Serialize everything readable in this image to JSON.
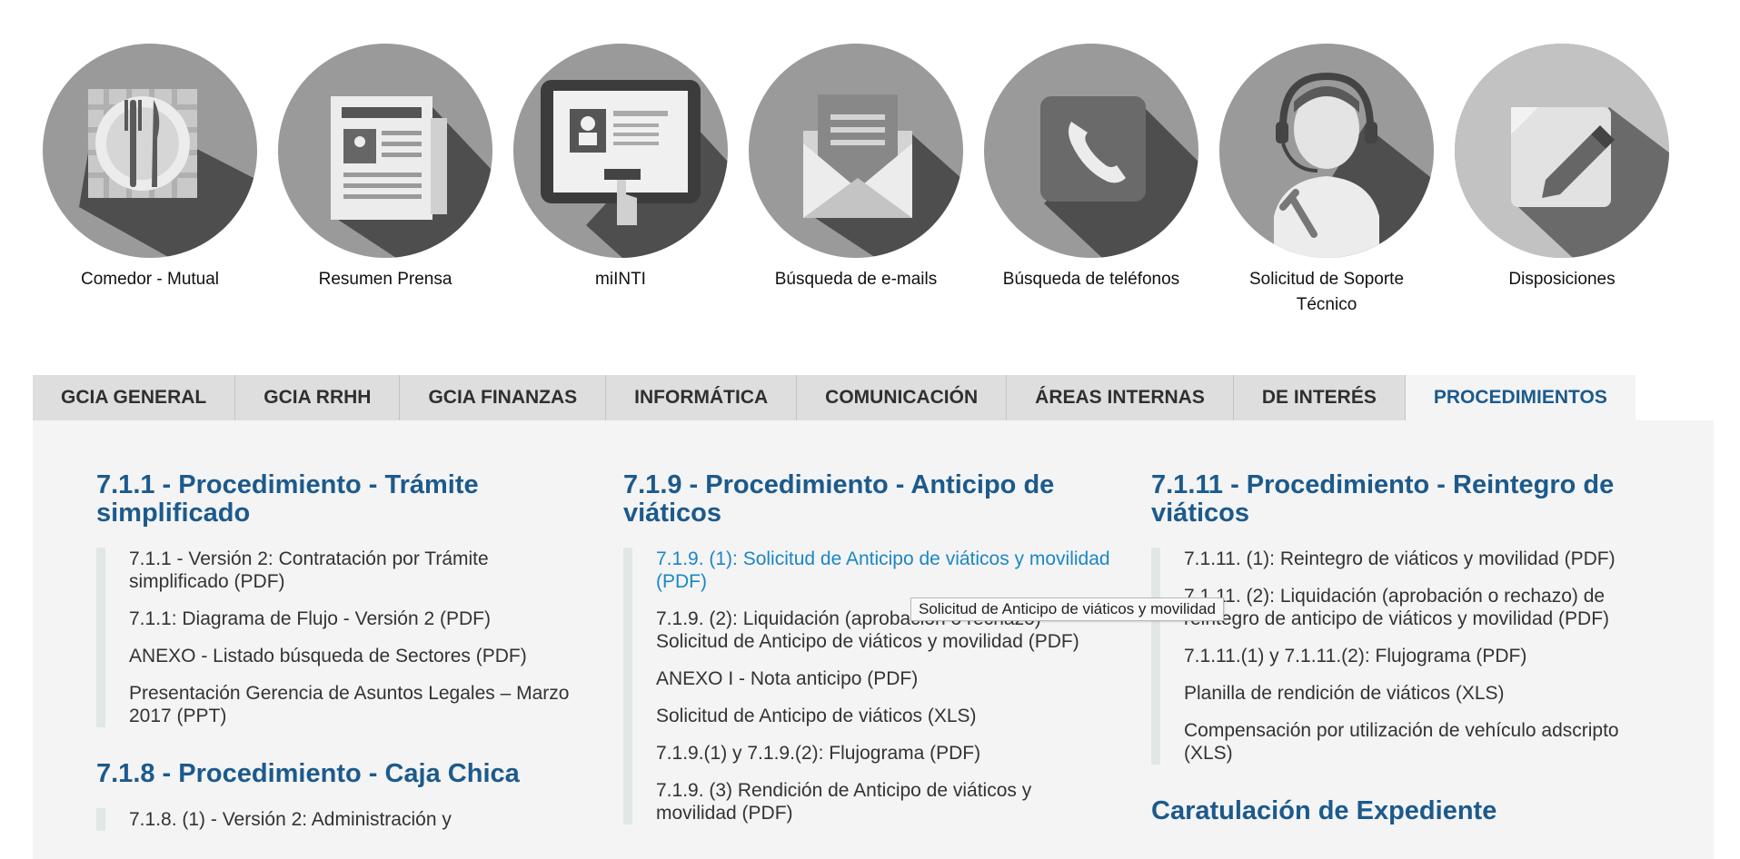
{
  "shortcuts": [
    {
      "label": "Comedor - Mutual",
      "icon": "dining-icon"
    },
    {
      "label": "Resumen Prensa",
      "icon": "newspaper-icon"
    },
    {
      "label": "miINTI",
      "icon": "tablet-profile-icon"
    },
    {
      "label": "Búsqueda de e-mails",
      "icon": "envelope-icon"
    },
    {
      "label": "Búsqueda de teléfonos",
      "icon": "phone-icon"
    },
    {
      "label": "Solicitud de Soporte Técnico",
      "icon": "support-agent-icon"
    },
    {
      "label": "Disposiciones",
      "icon": "pencil-note-icon"
    }
  ],
  "tabs": [
    {
      "label": "GCIA GENERAL"
    },
    {
      "label": "GCIA RRHH"
    },
    {
      "label": "GCIA FINANZAS"
    },
    {
      "label": "INFORMÁTICA"
    },
    {
      "label": "COMUNICACIÓN"
    },
    {
      "label": "ÁREAS INTERNAS"
    },
    {
      "label": "DE INTERÉS"
    },
    {
      "label": "PROCEDIMIENTOS",
      "active": true
    }
  ],
  "columns": [
    {
      "sections": [
        {
          "title": "7.1.1 - Procedimiento - Trámite simplificado",
          "items": [
            "7.1.1 - Versión 2: Contratación por Trámite simplificado (PDF)",
            "7.1.1: Diagrama de Flujo - Versión 2 (PDF)",
            "ANEXO - Listado búsqueda de Sectores (PDF)",
            "Presentación Gerencia de Asuntos Legales – Marzo 2017 (PPT)"
          ]
        },
        {
          "title": "7.1.8 - Procedimiento - Caja Chica",
          "items": [
            "7.1.8. (1) - Versión 2: Administración y"
          ]
        }
      ]
    },
    {
      "sections": [
        {
          "title": "7.1.9 - Procedimiento - Anticipo de viáticos",
          "items": [
            "7.1.9. (1): Solicitud de Anticipo de viáticos y movilidad (PDF)",
            "7.1.9. (2): Liquidación (aprobación o rechazo) Solicitud de Anticipo de viáticos y movilidad (PDF)",
            "ANEXO I - Nota anticipo (PDF)",
            "Solicitud de Anticipo de viáticos (XLS)",
            "7.1.9.(1) y 7.1.9.(2): Flujograma (PDF)",
            "7.1.9. (3) Rendición de Anticipo de viáticos y movilidad (PDF)"
          ]
        }
      ]
    },
    {
      "sections": [
        {
          "title": "7.1.11 - Procedimiento - Reintegro de viáticos",
          "items": [
            "7.1.11. (1): Reintegro de viáticos y movilidad (PDF)",
            "7.1.11. (2): Liquidación (aprobación o rechazo) de reintegro de anticipo de viáticos y movilidad (PDF)",
            "7.1.11.(1) y 7.1.11.(2): Flujograma (PDF)",
            "Planilla de rendición de viáticos (XLS)",
            "Compensación por utilización de vehículo adscripto (XLS)"
          ]
        },
        {
          "title": "Caratulación de Expediente",
          "items": []
        }
      ]
    }
  ],
  "tooltip": "Solicitud de Anticipo de viáticos y movilidad",
  "colors": {
    "accent": "#1c5a8c",
    "link_hover": "#1b86c6",
    "tab_bg": "#dedede",
    "panel_bg": "#f4f4f4"
  }
}
